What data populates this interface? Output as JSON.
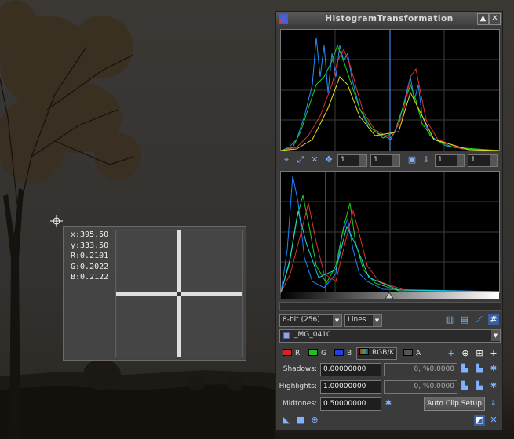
{
  "window": {
    "title": "HistogramTransformation"
  },
  "readout": {
    "x": "x:395.50",
    "y": "y:333.50",
    "r": "R:0.2101",
    "g": "G:0.2022",
    "b": "B:0.2122"
  },
  "toolbar": {
    "zoom_h": "1",
    "zoom_v": "1",
    "zoom_h2": "1",
    "zoom_v2": "1"
  },
  "settings": {
    "bit_depth": "8-bit (256)",
    "graph_style": "Lines"
  },
  "view": {
    "name": "_MG_0410"
  },
  "channels": [
    {
      "label": "R",
      "color": "#e02020"
    },
    {
      "label": "G",
      "color": "#20c020"
    },
    {
      "label": "B",
      "color": "#2040e0"
    },
    {
      "label": "RGB/K",
      "color": "#888888"
    },
    {
      "label": "A",
      "color": "#555555"
    }
  ],
  "params": {
    "shadows_label": "Shadows:",
    "shadows_value": "0.00000000",
    "shadows_clip": "0, %0.0000",
    "highlights_label": "Highlights:",
    "highlights_value": "1.00000000",
    "highlights_clip": "0, %0.0000",
    "midtones_label": "Midtones:",
    "midtones_value": "0.50000000",
    "auto_clip_label": "Auto Clip Setup"
  },
  "colors": {
    "accent": "#7fb2ff",
    "panel_bg": "#3b3b3b",
    "histogram_bg": "#000000"
  }
}
